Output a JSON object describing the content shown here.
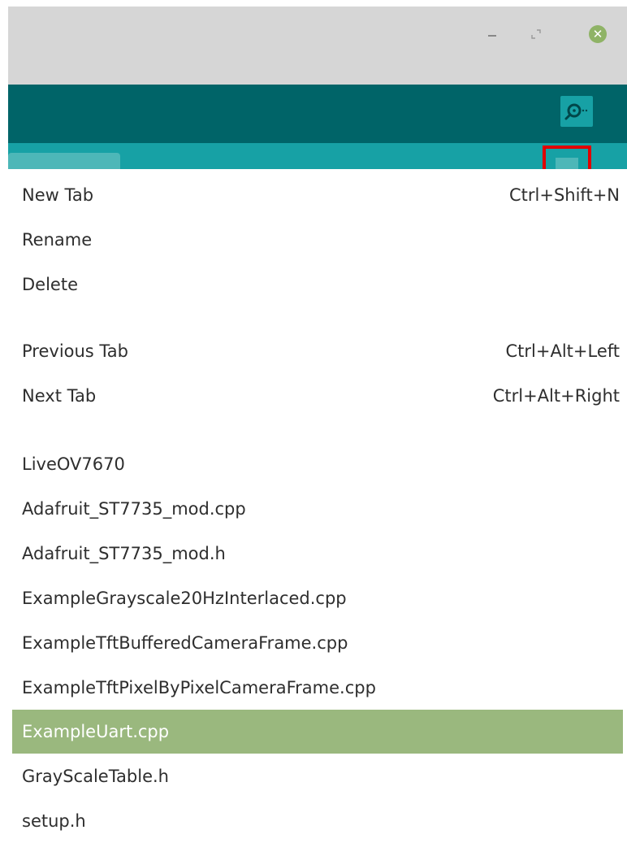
{
  "window": {
    "controls": {
      "minimize_icon": "minimize-icon",
      "maximize_icon": "maximize-icon",
      "close_icon": "close-icon",
      "close_symbol": "✕",
      "close_color": "#8fb366"
    }
  },
  "toolbar": {
    "background": "#006468",
    "serial_monitor_icon": "magnifier-icon"
  },
  "tabstrip": {
    "background": "#17a1a5",
    "tab_menu_icon": "dropdown-arrow-icon"
  },
  "menu": {
    "actions": [
      {
        "label": "New Tab",
        "shortcut": "Ctrl+Shift+N"
      },
      {
        "label": "Rename",
        "shortcut": ""
      },
      {
        "label": "Delete",
        "shortcut": ""
      }
    ],
    "navigation": [
      {
        "label": "Previous Tab",
        "shortcut": "Ctrl+Alt+Left"
      },
      {
        "label": "Next Tab",
        "shortcut": "Ctrl+Alt+Right"
      }
    ],
    "files": [
      {
        "label": "LiveOV7670",
        "selected": false
      },
      {
        "label": "Adafruit_ST7735_mod.cpp",
        "selected": false
      },
      {
        "label": "Adafruit_ST7735_mod.h",
        "selected": false
      },
      {
        "label": "ExampleGrayscale20HzInterlaced.cpp",
        "selected": false
      },
      {
        "label": "ExampleTftBufferedCameraFrame.cpp",
        "selected": false
      },
      {
        "label": "ExampleTftPixelByPixelCameraFrame.cpp",
        "selected": false
      },
      {
        "label": "ExampleUart.cpp",
        "selected": true
      },
      {
        "label": "GrayScaleTable.h",
        "selected": false
      },
      {
        "label": "setup.h",
        "selected": false
      }
    ],
    "highlight_color": "#9ab87e"
  }
}
